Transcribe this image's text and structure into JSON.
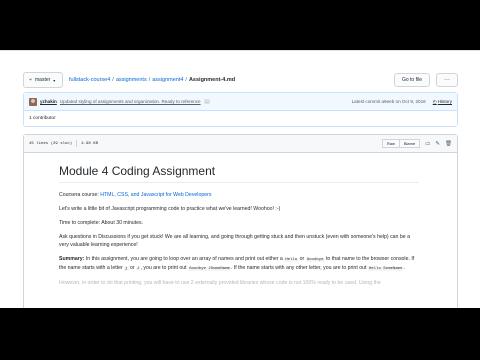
{
  "branch": {
    "label": "master"
  },
  "breadcrumb": {
    "repo": "fullstack-course4",
    "folder1": "assignments",
    "folder2": "assignment4",
    "file": "Assignment-4.md",
    "sep": "/"
  },
  "toolbar": {
    "goto_label": "Go to file",
    "more_label": "···"
  },
  "commit": {
    "author": "yzhakin",
    "message": "Updated styling of assignments and organization. Ready to reference",
    "ellipsis": "…",
    "latest": "Latest commit a9eeb on Oct 9, 2016",
    "history_label": "History"
  },
  "contributors": {
    "label": "1 contributor",
    "count_icon": "people-icon"
  },
  "file_info": {
    "lines": "45 lines (29 sloc)",
    "size": "4.98 KB"
  },
  "file_actions": {
    "raw": "Raw",
    "blame": "Blame"
  },
  "readme": {
    "title": "Module 4 Coding Assignment",
    "course_prefix": "Coursera course: ",
    "course_link": "HTML, CSS, and Javascript for Web Developers",
    "intro": "Let's write a little bit of Javascript programming code to practice what we've learned! Woohoo! :-)",
    "time_label": "Time to complete:",
    "time_value": " About 30 minutes.",
    "discussion": "Ask questions in Discussions if you get stuck! We are all learning, and going through getting stuck and then unstuck (even with someone's help) can be a very valuable learning experience!",
    "summary_label": "Summary:",
    "summary_1": " In this assignment, you are going to loop over an array of names and print out either a ",
    "code_hello": "Hello",
    "summary_or": " or ",
    "code_goodbye": "Goodbye",
    "summary_2": " to that name to the browser console. If the name starts with a letter ",
    "code_j": "j",
    "summary_or2": " or ",
    "code_J": "J",
    "summary_3": ", you are to print out ",
    "code_goodbye_name": "Goodbye JSomeName",
    "summary_4": ". If the name starts with any other letter, you are to print out ",
    "code_hello_name": "Hello SomeName",
    "summary_5": ".",
    "cut_line": "However, in order to do that printing, you will have to use 2 externally provided libraries whose code is not 100% ready to be used. Using the"
  }
}
